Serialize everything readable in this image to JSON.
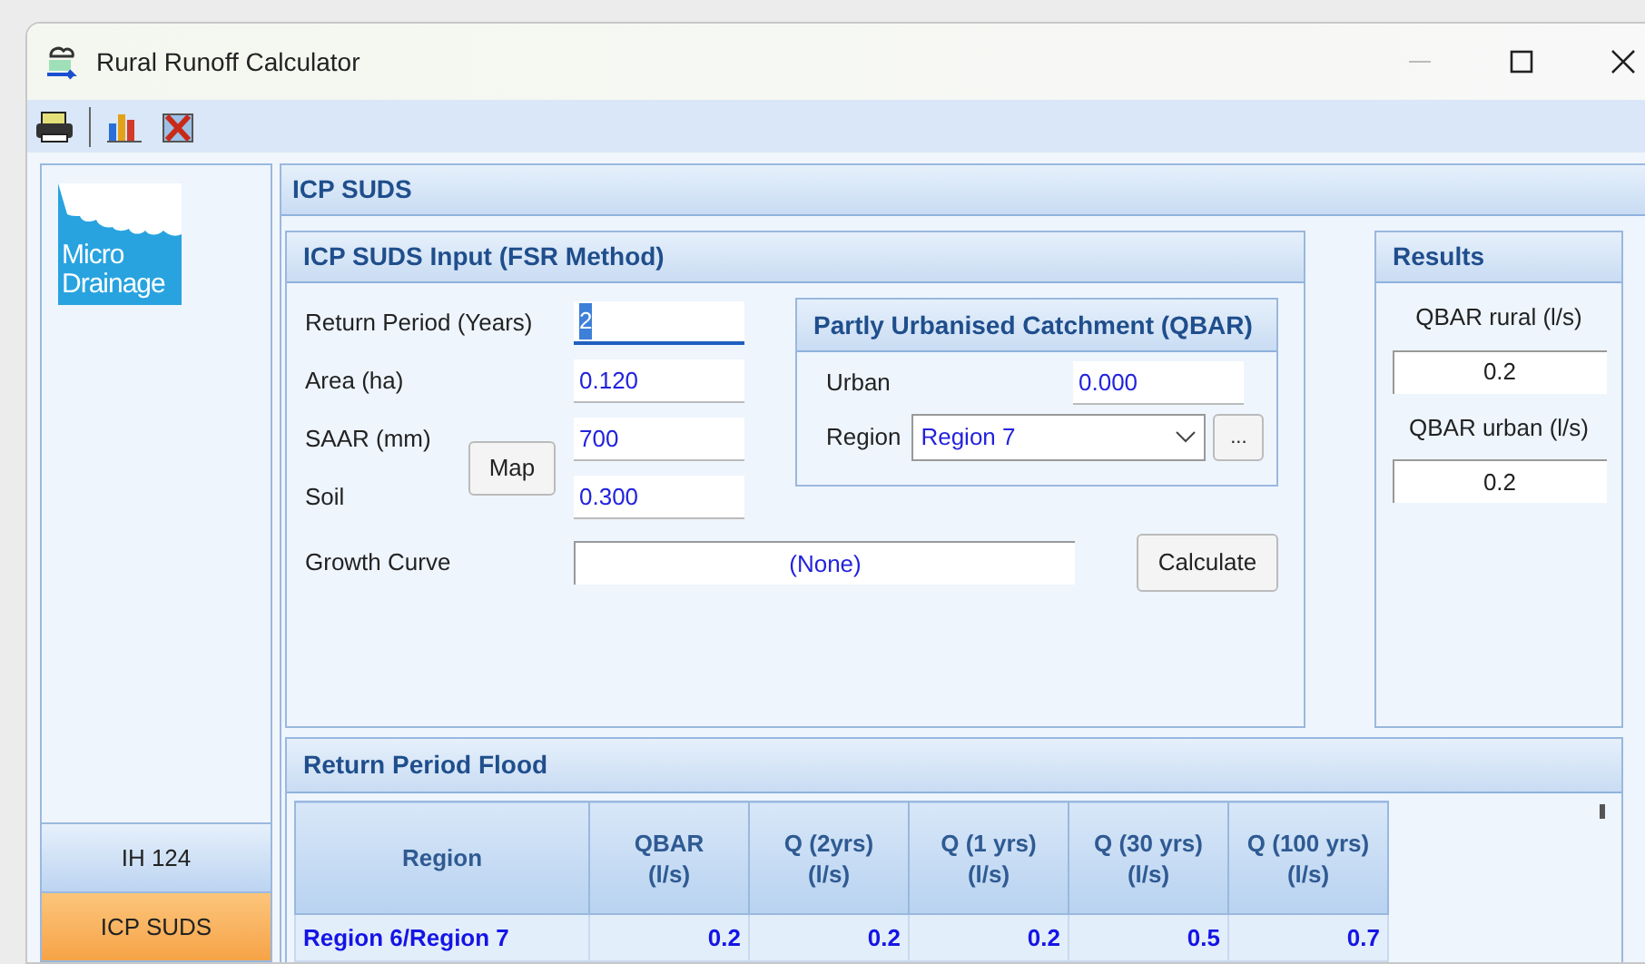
{
  "window": {
    "title": "Rural Runoff Calculator"
  },
  "sidebar": {
    "logo": [
      "Micro",
      "Drainage"
    ],
    "items": [
      {
        "label": "IH 124",
        "selected": false
      },
      {
        "label": "ICP SUDS",
        "selected": true
      }
    ]
  },
  "page_title": "ICP SUDS",
  "input_panel": {
    "title": "ICP SUDS Input (FSR Method)",
    "fields": [
      {
        "label": "Return Period (Years)",
        "value": "2",
        "focused": true
      },
      {
        "label": "Area (ha)",
        "value": "0.120",
        "focused": false
      },
      {
        "label": "SAAR (mm)",
        "value": "700",
        "focused": false
      },
      {
        "label": "Soil",
        "value": "0.300",
        "focused": false
      }
    ],
    "map_button": "Map",
    "growth_curve": {
      "label": "Growth Curve",
      "value": "(None)"
    },
    "calculate_button": "Calculate",
    "urban_panel": {
      "title": "Partly Urbanised Catchment (QBAR)",
      "urban_label": "Urban",
      "urban_value": "0.000",
      "region_label": "Region",
      "region_value": "Region 7",
      "more_button": "..."
    }
  },
  "results": {
    "title": "Results",
    "items": [
      {
        "label": "QBAR rural (l/s)",
        "value": "0.2"
      },
      {
        "label": "QBAR urban (l/s)",
        "value": "0.2"
      }
    ]
  },
  "flood_panel": {
    "title": "Return Period Flood",
    "table": {
      "columns": [
        "Region",
        "QBAR\n(l/s)",
        "Q (2yrs)\n(l/s)",
        "Q (1 yrs)\n(l/s)",
        "Q (30 yrs)\n(l/s)",
        "Q (100 yrs)\n(l/s)"
      ],
      "rows": [
        [
          "Region 6/Region 7",
          "0.2",
          "0.2",
          "0.2",
          "0.5",
          "0.7"
        ]
      ]
    }
  }
}
